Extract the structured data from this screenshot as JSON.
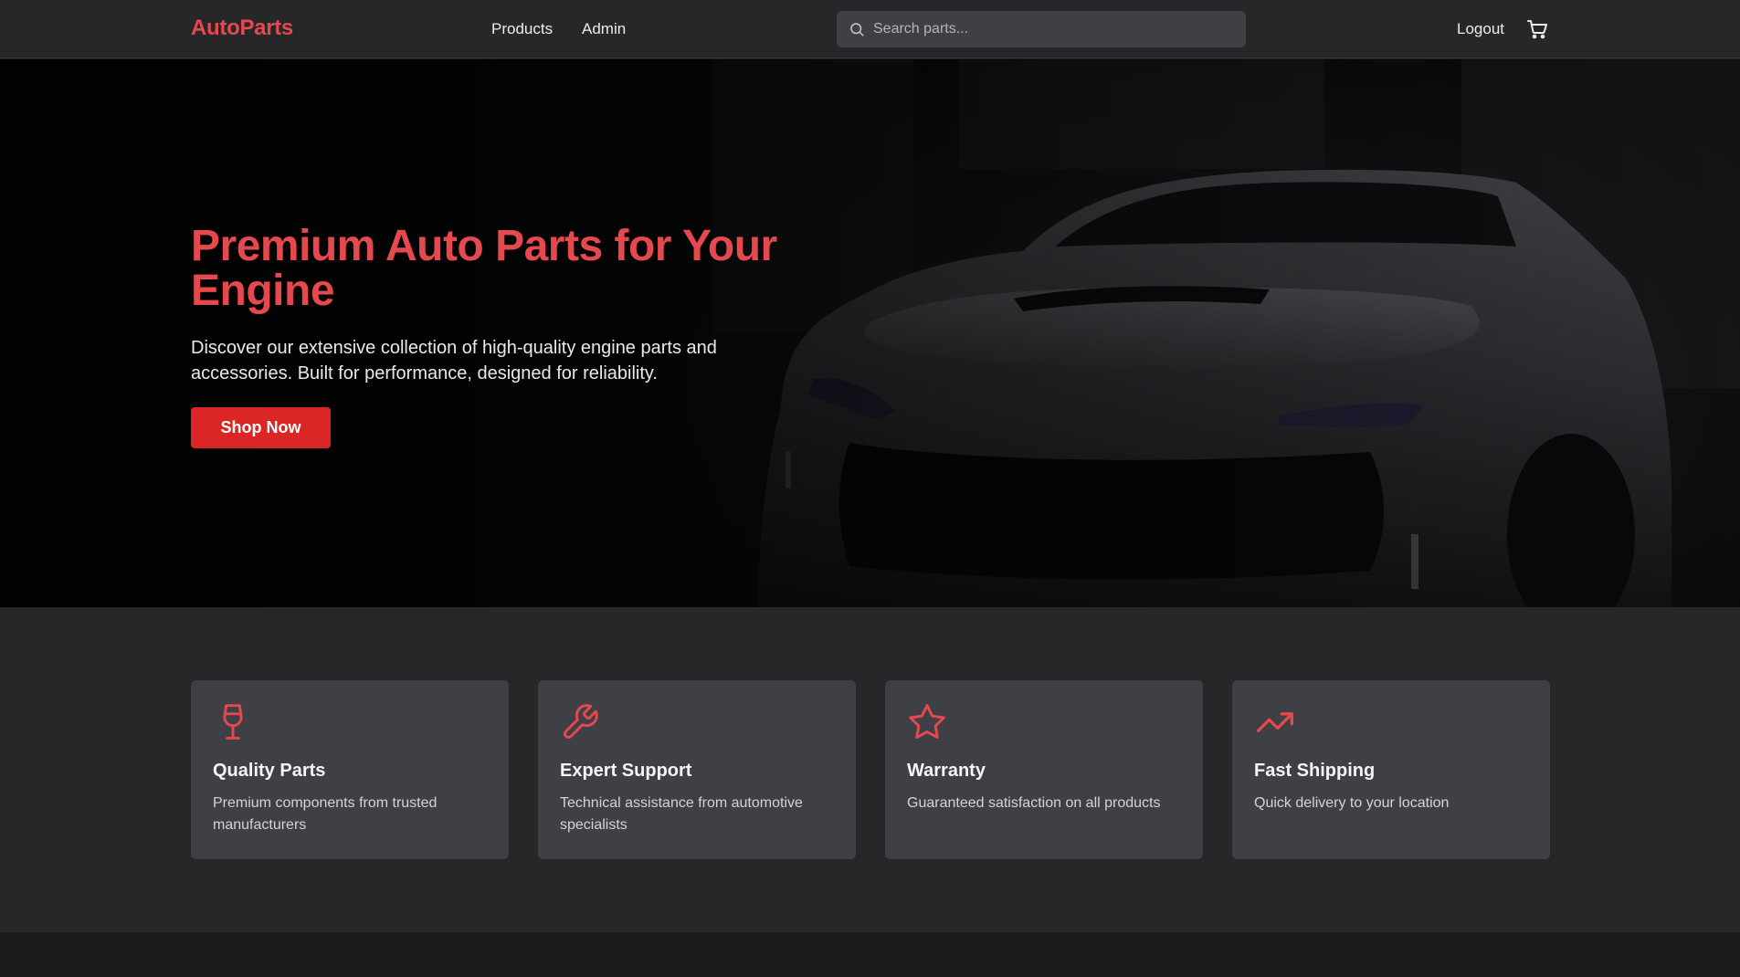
{
  "header": {
    "logo": "AutoParts",
    "nav": [
      {
        "label": "Products"
      },
      {
        "label": "Admin"
      }
    ],
    "search_placeholder": "Search parts...",
    "logout_label": "Logout",
    "cart_icon": "shopping-cart-icon"
  },
  "hero": {
    "title": "Premium Auto Parts for Your Engine",
    "subtitle": "Discover our extensive collection of high-quality engine parts and accessories. Built for performance, designed for reliability.",
    "cta_label": "Shop Now"
  },
  "features": [
    {
      "icon": "wine-glass-icon",
      "title": "Quality Parts",
      "desc": "Premium components from trusted manufacturers"
    },
    {
      "icon": "wrench-icon",
      "title": "Expert Support",
      "desc": "Technical assistance from automotive specialists"
    },
    {
      "icon": "star-icon",
      "title": "Warranty",
      "desc": "Guaranteed satisfaction on all products"
    },
    {
      "icon": "trending-up-icon",
      "title": "Fast Shipping",
      "desc": "Quick delivery to your location"
    }
  ],
  "colors": {
    "accent": "#e5484d",
    "button": "#dc2626",
    "header_bg": "#27272a",
    "card_bg": "#3f3f46",
    "page_bg": "#1c1c1f"
  }
}
